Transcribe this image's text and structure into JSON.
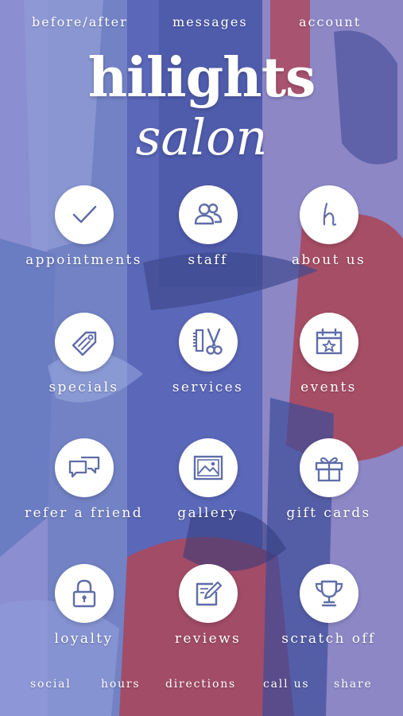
{
  "colors": {
    "icon": "#5f6da8",
    "text": "#ffffff",
    "circle": "#ffffff"
  },
  "top_nav": [
    {
      "label": "before/after"
    },
    {
      "label": "messages"
    },
    {
      "label": "account"
    }
  ],
  "title": {
    "main": "hilights",
    "sub": "salon"
  },
  "tiles": [
    {
      "label": "appointments",
      "icon": "checkmark-icon"
    },
    {
      "label": "staff",
      "icon": "people-icon"
    },
    {
      "label": "about us",
      "icon": "letter-h-icon"
    },
    {
      "label": "specials",
      "icon": "tag-icon"
    },
    {
      "label": "services",
      "icon": "comb-scissors-icon"
    },
    {
      "label": "events",
      "icon": "calendar-star-icon"
    },
    {
      "label": "refer a friend",
      "icon": "chat-bubbles-icon"
    },
    {
      "label": "gallery",
      "icon": "picture-icon"
    },
    {
      "label": "gift cards",
      "icon": "gift-icon"
    },
    {
      "label": "loyalty",
      "icon": "lock-icon"
    },
    {
      "label": "reviews",
      "icon": "note-pencil-icon"
    },
    {
      "label": "scratch off",
      "icon": "trophy-icon"
    }
  ],
  "bottom_nav": [
    {
      "label": "social"
    },
    {
      "label": "hours"
    },
    {
      "label": "directions"
    },
    {
      "label": "call us"
    },
    {
      "label": "share"
    }
  ]
}
